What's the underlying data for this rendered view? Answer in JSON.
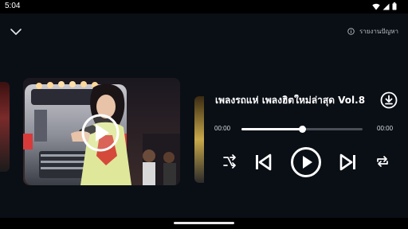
{
  "status_bar": {
    "time": "5:04",
    "icons": [
      "wifi-icon",
      "signal-icon",
      "battery-icon"
    ]
  },
  "header": {
    "collapse_icon": "chevron-down-icon",
    "report_icon": "info-icon",
    "report_label": "รายงานปัญหา"
  },
  "track": {
    "title": "เพลงรถแห่ เพลงฮิตใหม่ล่าสุด Vol.8",
    "download_icon": "download-icon",
    "artwork_overlay_icon": "play-icon"
  },
  "progress": {
    "elapsed": "00:00",
    "duration": "00:00",
    "position": 0.5
  },
  "controls": {
    "shuffle": "shuffle-icon",
    "previous": "skip-previous-icon",
    "play": "play-circle-icon",
    "next": "skip-next-icon",
    "repeat": "repeat-icon"
  },
  "colors": {
    "background": "#0a0f16",
    "accent": "#ffffff",
    "track_inactive": "#4a4f57"
  }
}
